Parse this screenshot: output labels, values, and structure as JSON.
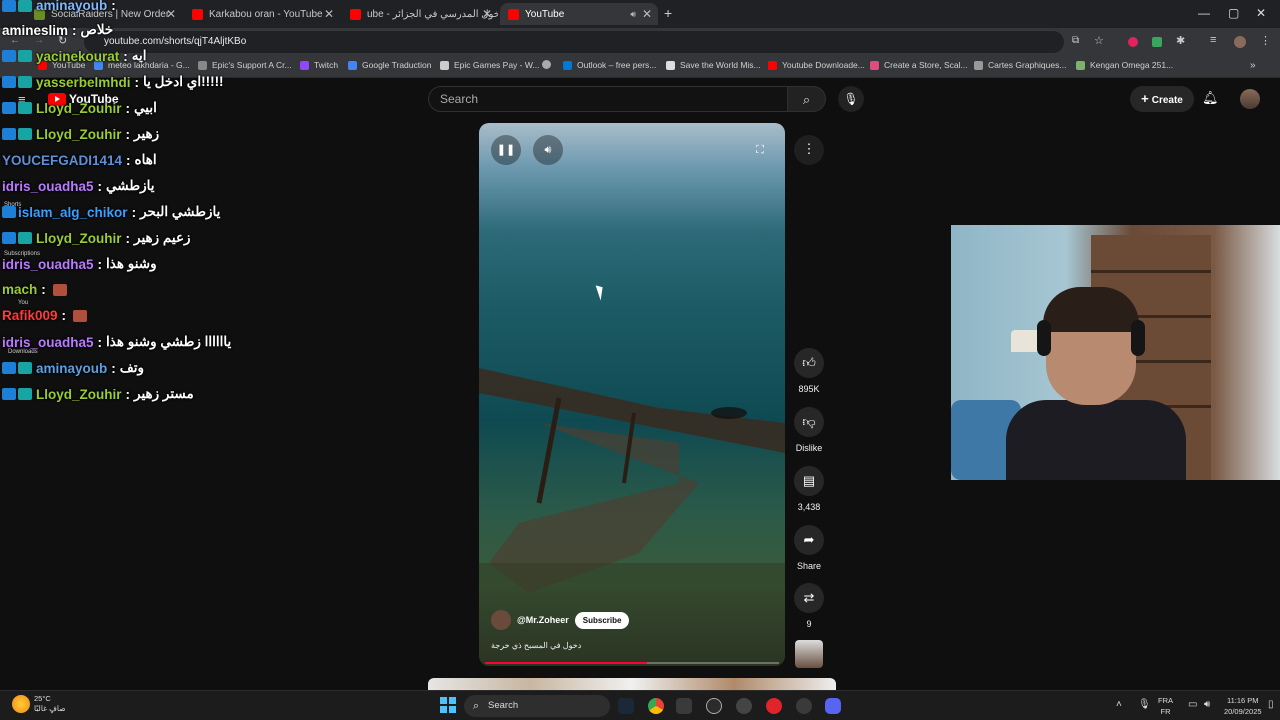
{
  "browser": {
    "tabs": [
      {
        "title": "SocialRaiders | New Order",
        "color": "#6b8e23"
      },
      {
        "title": "Karkabou oran - YouTube",
        "color": "#ff0000"
      },
      {
        "title": "ube - الدخول المدرسي في الجزائر",
        "color": "#ff0000"
      },
      {
        "title": "YouTube",
        "color": "#ff0000"
      }
    ],
    "url": "youtube.com/shorts/qjT4AljtKBo",
    "bookmarks": [
      {
        "label": "YouTube",
        "color": "#ff0000"
      },
      {
        "label": "meteo lakhdaria - G...",
        "color": "#4285f4"
      },
      {
        "label": "Epic's Support A Cr...",
        "color": "#888888"
      },
      {
        "label": "Twitch",
        "color": "#9146ff"
      },
      {
        "label": "Google Traduction",
        "color": "#4285f4"
      },
      {
        "label": "Epic Games Pay - W...",
        "color": "#cccccc"
      },
      {
        "label": "",
        "color": "#aaaaaa"
      },
      {
        "label": "Outlook – free pers...",
        "color": "#0078d4"
      },
      {
        "label": "Save the World Mis...",
        "color": "#dddddd"
      },
      {
        "label": "Youtube Downloade...",
        "color": "#ff0000"
      },
      {
        "label": "Create a Store, Scal...",
        "color": "#e24b7b"
      },
      {
        "label": "Cartes Graphiques...",
        "color": "#999999"
      },
      {
        "label": "Kengan Omega 251...",
        "color": "#7bb36b"
      }
    ]
  },
  "youtube": {
    "logo": "YouTube",
    "search_placeholder": "Search",
    "create_label": "Create",
    "sidebar": [
      "Shorts",
      "Subscriptions",
      "You",
      "Downloads"
    ]
  },
  "chat": [
    {
      "user": "aminayoub",
      "text": "",
      "color": "#7fb8ff",
      "badges": 2
    },
    {
      "user": "amineslim",
      "text": "خلاص",
      "color": "#ffffff",
      "badges": 0
    },
    {
      "user": "yacinekourat",
      "text": "ايه",
      "color": "#9acd32",
      "badges": 2
    },
    {
      "user": "yasserbelmhdi",
      "text": "اي ادخل يا!!!!!",
      "color": "#9acd32",
      "badges": 2
    },
    {
      "user": "Lloyd_Zouhir",
      "text": "ابيي",
      "color": "#9acd32",
      "badges": 2
    },
    {
      "user": "Lloyd_Zouhir",
      "text": "زهير",
      "color": "#9acd32",
      "badges": 2
    },
    {
      "user": "YOUCEFGADI1414",
      "text": "اهاه",
      "color": "#5f8fd6",
      "badges": 0
    },
    {
      "user": "idris_ouadha5",
      "text": "يازطشي",
      "color": "#b97bff",
      "badges": 0
    },
    {
      "user": "islam_alg_chikor",
      "text": "يازطشي البحر",
      "color": "#3aa0ff",
      "badges": 1
    },
    {
      "user": "Lloyd_Zouhir",
      "text": "زعيم زهير",
      "color": "#9acd32",
      "badges": 2
    },
    {
      "user": "idris_ouadha5",
      "text": "وشنو هذا",
      "color": "#b97bff",
      "badges": 0
    },
    {
      "user": "mach",
      "text": "",
      "color": "#9acd32",
      "badges": 0,
      "emote": true
    },
    {
      "user": "Rafik009",
      "text": "",
      "color": "#ff3b3b",
      "badges": 0,
      "emote": true
    },
    {
      "user": "idris_ouadha5",
      "text": "ياااااا زطشي وشنو هذا",
      "color": "#b97bff",
      "badges": 0
    },
    {
      "user": "aminayoub",
      "text": "وتف",
      "color": "#5f9fe0",
      "badges": 2
    },
    {
      "user": "Lloyd_Zouhir",
      "text": "مستر زهير",
      "color": "#9acd32",
      "badges": 2
    }
  ],
  "short": {
    "channel": "@Mr.Zoheer",
    "subscribe_label": "Subscribe",
    "caption": "دخول في المسبح ذي خرجة",
    "progress": 0.55,
    "actions": {
      "likes": "895K",
      "dislike_label": "Dislike",
      "comments": "3,438",
      "share_label": "Share",
      "remix_count": "9"
    }
  },
  "taskbar": {
    "temp": "25°C",
    "weather": "صافٍ غالبًا",
    "search_label": "Search",
    "lang_top": "FRA",
    "lang_bottom": "FR",
    "time": "11:16 PM",
    "date": "20/09/2025"
  }
}
